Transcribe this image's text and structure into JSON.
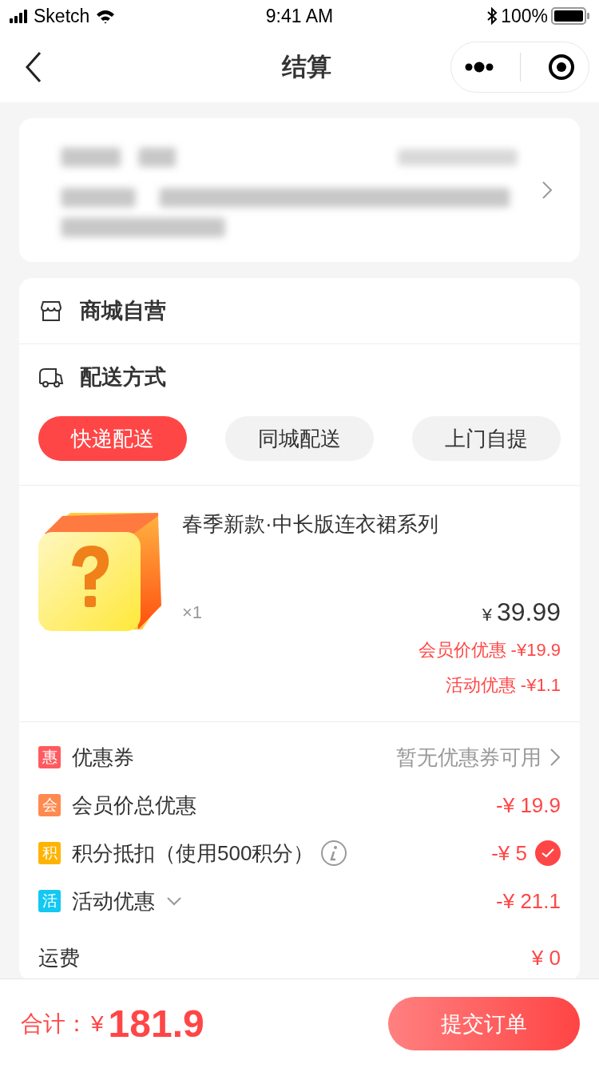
{
  "status_bar": {
    "carrier": "Sketch",
    "time": "9:41 AM",
    "battery": "100%"
  },
  "nav": {
    "title": "结算"
  },
  "store": {
    "name": "商城自营"
  },
  "delivery": {
    "title": "配送方式",
    "options": [
      {
        "label": "快递配送",
        "selected": true
      },
      {
        "label": "同城配送",
        "selected": false
      },
      {
        "label": "上门自提",
        "selected": false
      }
    ]
  },
  "product": {
    "title": "春季新款·中长版连衣裙系列",
    "quantity": "×1",
    "price_symbol": "¥",
    "price": "39.99",
    "discounts": [
      "会员价优惠 -¥19.9",
      "活动优惠 -¥1.1"
    ]
  },
  "summary": [
    {
      "kind": "link",
      "badge": "惠",
      "color": "#ff5a5f",
      "label": "优惠券",
      "value": "暂无优惠券可用"
    },
    {
      "kind": "amount",
      "badge": "会",
      "color": "#ff8a50",
      "label": "会员价总优惠",
      "value": "-¥ 19.9"
    },
    {
      "kind": "check",
      "badge": "积",
      "color": "#ffb300",
      "label": "积分抵扣（使用500积分）",
      "info": true,
      "value": "-¥ 5",
      "checked": true
    },
    {
      "kind": "dropdown",
      "badge": "活",
      "color": "#13c8f2",
      "label": "活动优惠",
      "value": "-¥ 21.1"
    },
    {
      "kind": "plain",
      "label": "运费",
      "value": "¥ 0"
    }
  ],
  "footer": {
    "total_label": "合计：",
    "currency": "¥",
    "total": "181.9",
    "submit": "提交订单"
  }
}
